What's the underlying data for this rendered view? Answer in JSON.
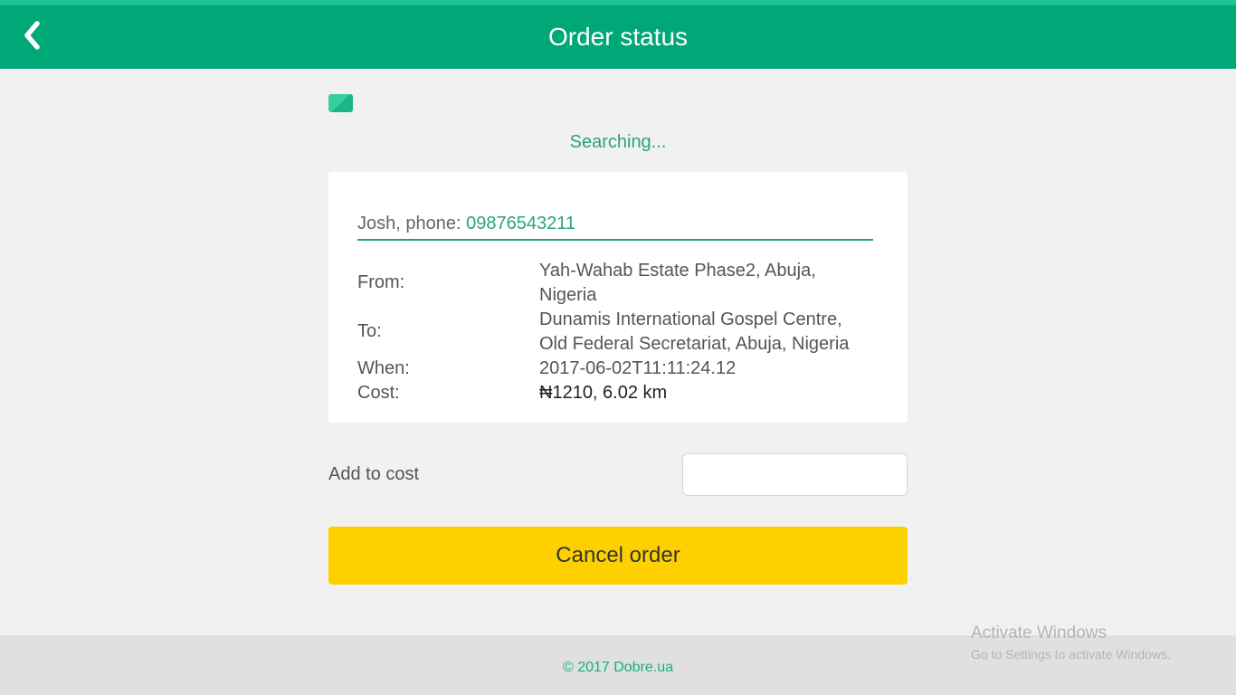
{
  "header": {
    "title": "Order status",
    "back_icon": "chevron-left-icon"
  },
  "status": {
    "icon": "status-card-icon",
    "text": "Searching..."
  },
  "order": {
    "contact_prefix": "Josh, phone: ",
    "phone": "09876543211",
    "from_label": "From:",
    "from_value": "Yah-Wahab Estate Phase2, Abuja, Nigeria",
    "to_label": "To:",
    "to_value": "Dunamis International Gospel Centre, Old Federal Secretariat, Abuja, Nigeria",
    "when_label": "When:",
    "when_value": "2017-06-02T11:11:24.12",
    "cost_label": "Cost:",
    "cost_value": "₦1210, 6.02 km"
  },
  "add_cost": {
    "label": "Add to cost",
    "value": "",
    "placeholder": ""
  },
  "actions": {
    "cancel_label": "Cancel order"
  },
  "footer": {
    "copyright": "© 2017 Dobre.ua"
  },
  "watermark": {
    "title": "Activate Windows",
    "subtitle": "Go to Settings to activate Windows."
  },
  "colors": {
    "header_bg": "#00a878",
    "accent_green": "#2aa47a",
    "cancel_button": "#ffd000",
    "footer_bg": "#e0e0e0"
  }
}
